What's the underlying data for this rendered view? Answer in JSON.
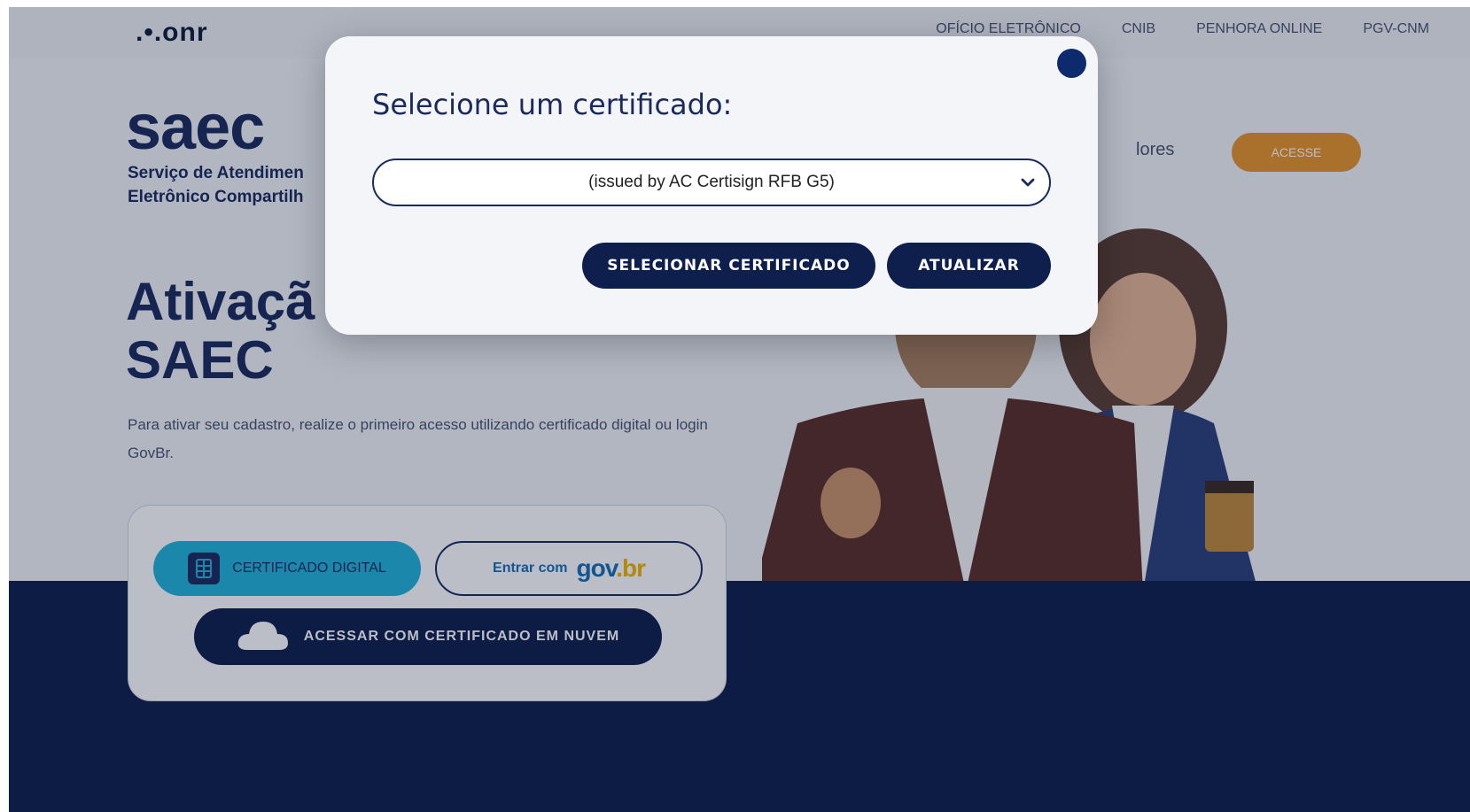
{
  "topbar": {
    "logo": ".•.onr",
    "links": [
      "OFÍCIO ELETRÔNICO",
      "CNIB",
      "PENHORA ONLINE",
      "PGV-CNM"
    ]
  },
  "hero": {
    "brand": "saec",
    "brand_sub_1": "Serviço de Atendimen",
    "brand_sub_2": "Eletrônico Compartilh",
    "nav_partial": "lores",
    "acesse_label": "ACESSE",
    "title_1": "Ativaçã",
    "title_2": "SAEC",
    "description": "Para ativar seu cadastro, realize o primeiro acesso utilizando certificado digital ou login GovBr."
  },
  "login": {
    "cert_label": "CERTIFICADO DIGITAL",
    "govbr_prefix": "Entrar com",
    "govbr_logo_a": "gov",
    "govbr_logo_b": ".br",
    "nuvem_label": "ACESSAR COM CERTIFICADO EM NUVEM"
  },
  "modal": {
    "title": "Selecione um certificado:",
    "selected_certificate": "(issued by AC Certisign RFB G5)",
    "select_button": "SELECIONAR CERTIFICADO",
    "update_button": "ATUALIZAR"
  },
  "colors": {
    "navy": "#0e1f4d",
    "brand": "#1a2a5e",
    "accent_orange": "#e8952a",
    "accent_cyan": "#22b3d8"
  }
}
